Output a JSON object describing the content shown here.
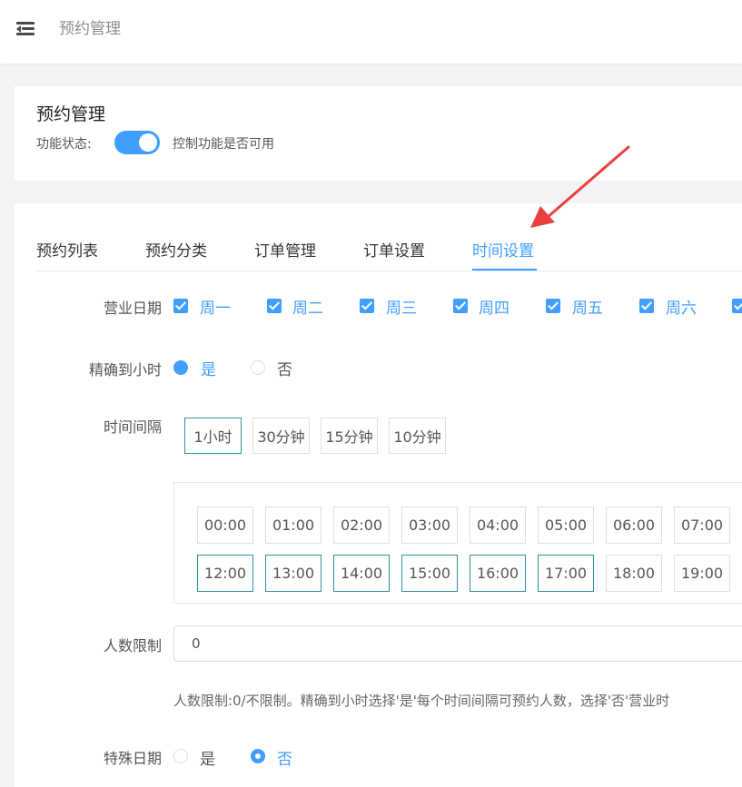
{
  "header": {
    "title": "预约管理",
    "menu_icon": "menu-fold-icon"
  },
  "module": {
    "title": "预约管理",
    "status_label": "功能状态:",
    "status_on": true,
    "status_desc": "控制功能是否可用"
  },
  "tabs": [
    {
      "label": "预约列表",
      "active": false
    },
    {
      "label": "预约分类",
      "active": false
    },
    {
      "label": "订单管理",
      "active": false
    },
    {
      "label": "订单设置",
      "active": false
    },
    {
      "label": "时间设置",
      "active": true
    }
  ],
  "form": {
    "business_days": {
      "label": "营业日期",
      "days": [
        {
          "label": "周一",
          "checked": true
        },
        {
          "label": "周二",
          "checked": true
        },
        {
          "label": "周三",
          "checked": true
        },
        {
          "label": "周四",
          "checked": true
        },
        {
          "label": "周五",
          "checked": true
        },
        {
          "label": "周六",
          "checked": true
        },
        {
          "label": "",
          "checked": true
        }
      ]
    },
    "exact_hour": {
      "label": "精确到小时",
      "options": [
        {
          "label": "是",
          "selected": true
        },
        {
          "label": "否",
          "selected": false
        }
      ]
    },
    "interval": {
      "label": "时间间隔",
      "options": [
        {
          "label": "1小时",
          "selected": true
        },
        {
          "label": "30分钟",
          "selected": false
        },
        {
          "label": "15分钟",
          "selected": false
        },
        {
          "label": "10分钟",
          "selected": false
        }
      ]
    },
    "slots": {
      "row1": [
        {
          "label": "00:00",
          "selected": false
        },
        {
          "label": "01:00",
          "selected": false
        },
        {
          "label": "02:00",
          "selected": false
        },
        {
          "label": "03:00",
          "selected": false
        },
        {
          "label": "04:00",
          "selected": false
        },
        {
          "label": "05:00",
          "selected": false
        },
        {
          "label": "06:00",
          "selected": false
        },
        {
          "label": "07:00",
          "selected": false
        }
      ],
      "row2": [
        {
          "label": "12:00",
          "selected": true
        },
        {
          "label": "13:00",
          "selected": true
        },
        {
          "label": "14:00",
          "selected": true
        },
        {
          "label": "15:00",
          "selected": true
        },
        {
          "label": "16:00",
          "selected": true
        },
        {
          "label": "17:00",
          "selected": true
        },
        {
          "label": "18:00",
          "selected": false
        },
        {
          "label": "19:00",
          "selected": false
        }
      ]
    },
    "people_limit": {
      "label": "人数限制",
      "value": "0",
      "hint": "人数限制:0/不限制。精确到小时选择'是'每个时间间隔可预约人数，选择'否'营业时"
    },
    "special_date": {
      "label": "特殊日期",
      "options": [
        {
          "label": "是",
          "selected": false
        },
        {
          "label": "否",
          "selected": true
        }
      ]
    }
  },
  "colors": {
    "accent": "#409eff",
    "selected_border": "#2f8f9d",
    "annotation_arrow": "#e8403f"
  }
}
